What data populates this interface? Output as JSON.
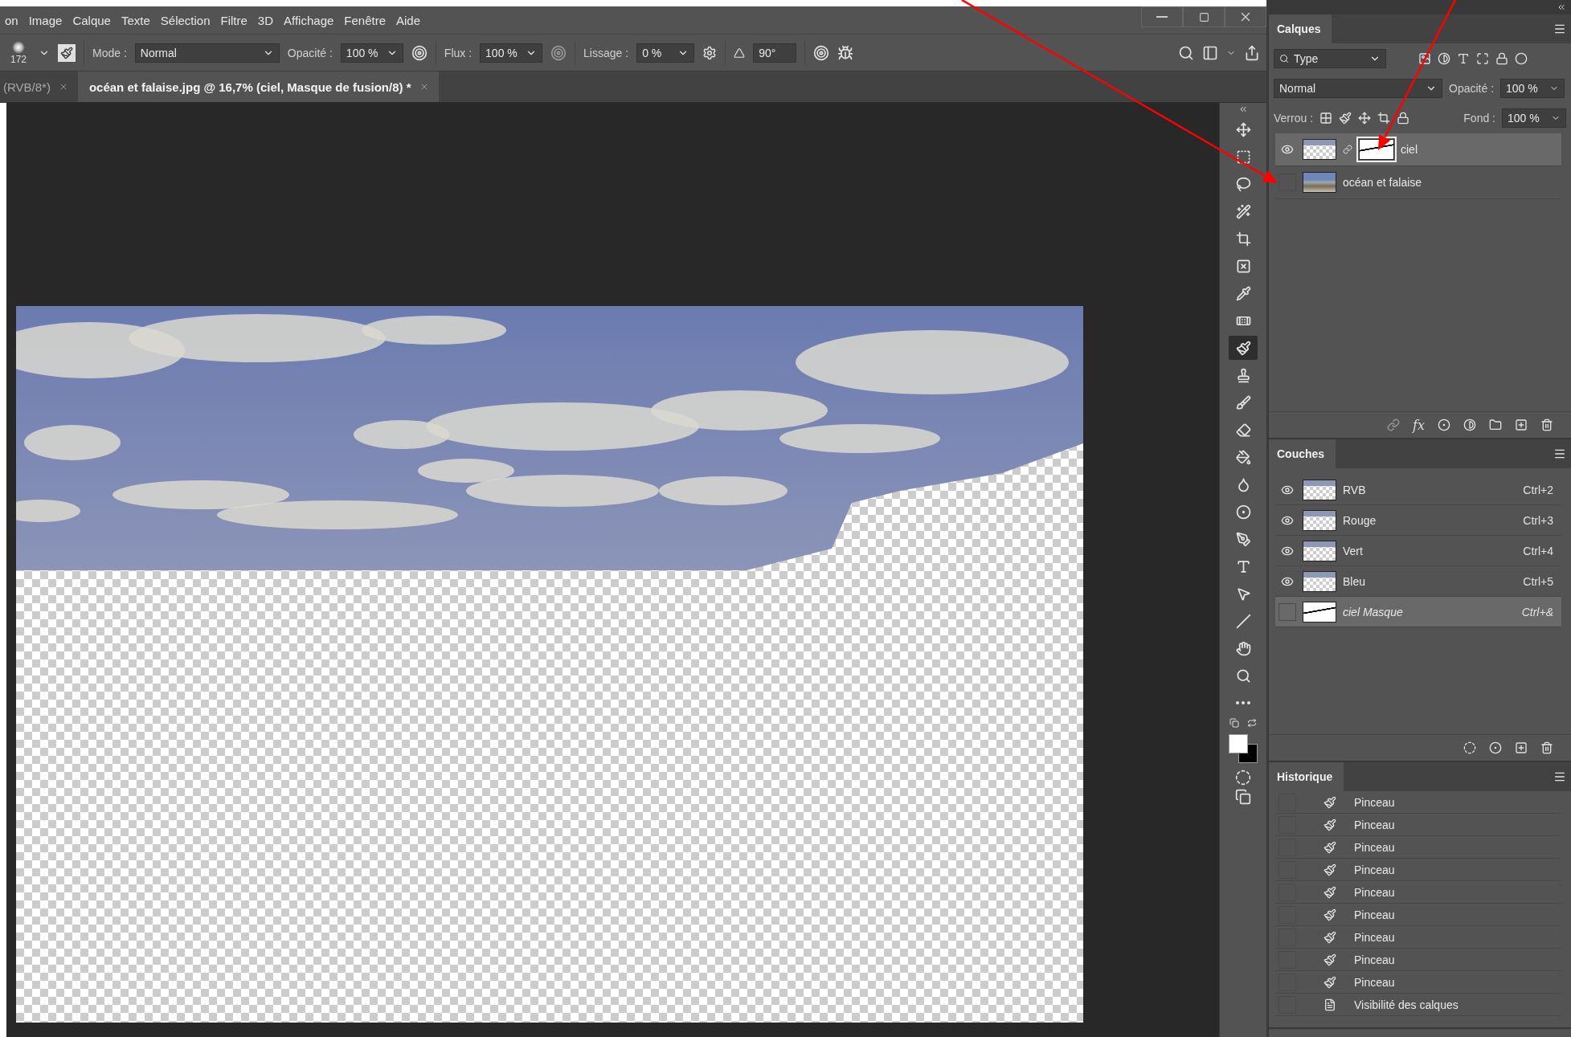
{
  "menu_bar": {
    "items": [
      "on",
      "Image",
      "Calque",
      "Texte",
      "Sélection",
      "Filtre",
      "3D",
      "Affichage",
      "Fenêtre",
      "Aide"
    ]
  },
  "options_bar": {
    "brush_size": "172",
    "mode_label": "Mode :",
    "mode_value": "Normal",
    "opacity_label": "Opacité :",
    "opacity_value": "100 %",
    "flow_label": "Flux :",
    "flow_value": "100 %",
    "smoothing_label": "Lissage :",
    "smoothing_value": "0 %",
    "angle_value": "90°"
  },
  "document_tabs": [
    {
      "label": "(RVB/8*)",
      "selected": false
    },
    {
      "label": "océan et falaise.jpg @ 16,7% (ciel, Masque de fusion/8) *",
      "selected": true
    }
  ],
  "tools": [
    {
      "kind": "move",
      "selected": false
    },
    {
      "kind": "marquee",
      "selected": false
    },
    {
      "kind": "lasso",
      "selected": false
    },
    {
      "kind": "quick-select",
      "selected": false
    },
    {
      "kind": "crop",
      "selected": false
    },
    {
      "kind": "frame",
      "selected": false
    },
    {
      "kind": "eyedropper",
      "selected": false
    },
    {
      "kind": "healing",
      "selected": false
    },
    {
      "kind": "brush",
      "selected": true
    },
    {
      "kind": "stamp",
      "selected": false
    },
    {
      "kind": "history-brush",
      "selected": false
    },
    {
      "kind": "eraser",
      "selected": false
    },
    {
      "kind": "bucket",
      "selected": false
    },
    {
      "kind": "blur",
      "selected": false
    },
    {
      "kind": "dodge",
      "selected": false
    },
    {
      "kind": "pen",
      "selected": false
    },
    {
      "kind": "type",
      "selected": false
    },
    {
      "kind": "path-select",
      "selected": false
    },
    {
      "kind": "line",
      "selected": false
    },
    {
      "kind": "hand",
      "selected": false
    },
    {
      "kind": "zoom",
      "selected": false
    },
    {
      "kind": "more",
      "selected": false
    }
  ],
  "layers_panel": {
    "title": "Calques",
    "filter": "Type",
    "blend_mode": "Normal",
    "opacity_label": "Opacité :",
    "opacity_value": "100 %",
    "lock_label": "Verrou :",
    "fill_label": "Fond :",
    "fill_value": "100 %",
    "effects_label": "fx",
    "layers": [
      {
        "name": "ciel",
        "visible": true,
        "selected": true,
        "has_mask": true
      },
      {
        "name": "océan et falaise",
        "visible": false,
        "selected": false,
        "has_mask": false
      }
    ]
  },
  "channels_panel": {
    "title": "Couches",
    "channels": [
      {
        "name": "RVB",
        "shortcut": "Ctrl+2",
        "visible": true,
        "selected": false,
        "kind": "color"
      },
      {
        "name": "Rouge",
        "shortcut": "Ctrl+3",
        "visible": true,
        "selected": false,
        "kind": "color"
      },
      {
        "name": "Vert",
        "shortcut": "Ctrl+4",
        "visible": true,
        "selected": false,
        "kind": "color"
      },
      {
        "name": "Bleu",
        "shortcut": "Ctrl+5",
        "visible": true,
        "selected": false,
        "kind": "color"
      },
      {
        "name": "ciel Masque",
        "shortcut": "Ctrl+&",
        "visible": false,
        "selected": true,
        "kind": "mask"
      }
    ]
  },
  "history_panel": {
    "title": "Historique",
    "steps": [
      {
        "label": "Pinceau",
        "kind": "brush"
      },
      {
        "label": "Pinceau",
        "kind": "brush"
      },
      {
        "label": "Pinceau",
        "kind": "brush"
      },
      {
        "label": "Pinceau",
        "kind": "brush"
      },
      {
        "label": "Pinceau",
        "kind": "brush"
      },
      {
        "label": "Pinceau",
        "kind": "brush"
      },
      {
        "label": "Pinceau",
        "kind": "brush"
      },
      {
        "label": "Pinceau",
        "kind": "brush"
      },
      {
        "label": "Pinceau",
        "kind": "brush"
      },
      {
        "label": "Visibilité des calques",
        "kind": "document"
      }
    ]
  }
}
